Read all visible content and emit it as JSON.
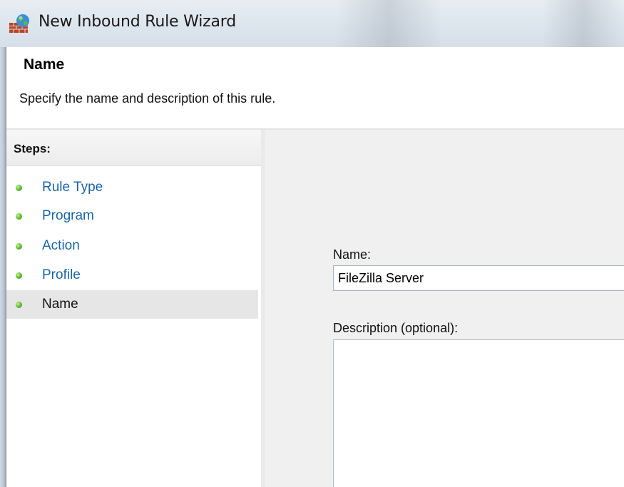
{
  "window": {
    "title": "New Inbound Rule Wizard",
    "icon": "firewall-globe-icon"
  },
  "header": {
    "title": "Name",
    "description": "Specify the name and description of this rule."
  },
  "steps": {
    "label": "Steps:",
    "items": [
      {
        "label": "Rule Type",
        "status": "complete"
      },
      {
        "label": "Program",
        "status": "complete"
      },
      {
        "label": "Action",
        "status": "complete"
      },
      {
        "label": "Profile",
        "status": "complete"
      },
      {
        "label": "Name",
        "status": "current"
      }
    ]
  },
  "form": {
    "name_label": "Name:",
    "name_value": "FileZilla Server",
    "description_label": "Description (optional):",
    "description_value": ""
  },
  "colors": {
    "link": "#1a64a8",
    "bullet": "#4caf2a",
    "content_bg": "#f0f0f0",
    "active_step_bg": "#e6e6e6"
  }
}
